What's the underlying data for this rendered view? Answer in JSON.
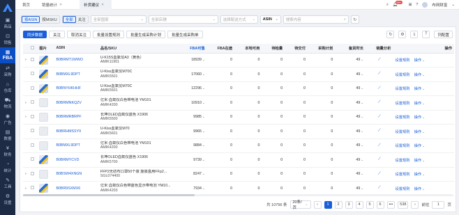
{
  "sidebar": {
    "items": [
      {
        "label": "商品",
        "icon": "box-icon"
      },
      {
        "label": "销售",
        "icon": "cart-icon"
      },
      {
        "label": "FBA",
        "icon": "fba-icon",
        "active": true
      },
      {
        "label": "采购",
        "icon": "purchase-icon"
      },
      {
        "label": "仓库",
        "icon": "warehouse-icon"
      },
      {
        "label": "物流",
        "icon": "truck-icon"
      },
      {
        "label": "广告",
        "icon": "ad-icon"
      },
      {
        "label": "数据",
        "icon": "chart-icon"
      },
      {
        "label": "财务",
        "icon": "finance-icon"
      },
      {
        "label": "统计",
        "icon": "stats-icon"
      },
      {
        "label": "工具",
        "icon": "tool-icon"
      },
      {
        "label": "设置",
        "icon": "settings-icon"
      }
    ]
  },
  "tabs": [
    {
      "label": "首页"
    },
    {
      "label": "销量统计"
    },
    {
      "label": "补货建议",
      "active": true
    }
  ],
  "topright": {
    "user": "布网财富",
    "badge": "99+"
  },
  "filters": {
    "seg1": [
      "按ASIN",
      "按MSKU"
    ],
    "seg2": [
      "全部",
      "关注"
    ],
    "country": "全部国家",
    "store": "全部店铺",
    "shipping": "选择配送方式",
    "search_field": "ASIN",
    "search_placeholder": "搜索内容"
  },
  "actions": [
    "同步数据",
    "关注",
    "取消关注",
    "批量设置规则",
    "批量生成采购计划",
    "批量生成采购单"
  ],
  "tools": {
    "column_config": "列配置"
  },
  "table": {
    "headers": [
      "图片",
      "ASIN",
      "品名/SKU",
      "FBA可售",
      "FBA在途",
      "本地可用",
      "待检量",
      "待交付",
      "采购计划",
      "备货时长",
      "销量分析",
      "操作"
    ],
    "rows": [
      {
        "asin": "B0BRMT1WWO",
        "name": "U-K15S血氧仪A3（黄色）",
        "sku": "AMIK11901",
        "fba": "18939",
        "inbound": "0",
        "local": "0",
        "inspect": "0",
        "deliver": "0",
        "plan": "0",
        "lead": "49",
        "expand": true,
        "pic": true
      },
      {
        "asin": "B0BMXL9DPT",
        "name": "U-Kiss血氧仪M70C",
        "sku": "AMIK5501",
        "fba": "17060",
        "inbound": "0",
        "local": "0",
        "inspect": "0",
        "deliver": "0",
        "plan": "0",
        "lead": "49",
        "expand": false,
        "pic": true
      },
      {
        "asin": "B0BNYHKHHF",
        "name": "U-Kiss血氧仪M70C",
        "sku": "AMIK5501",
        "fba": "12296",
        "inbound": "0",
        "local": "0",
        "inspect": "0",
        "deliver": "0",
        "plan": "0",
        "lead": "49",
        "expand": false,
        "pic": true
      },
      {
        "asin": "B0BRMNKQZV",
        "name": "亿米 血氧仪白色带电池 YM101",
        "sku": "AMIK4200",
        "fba": "10910",
        "inbound": "0",
        "local": "0",
        "inspect": "0",
        "deliver": "0",
        "plan": "0",
        "lead": "49",
        "expand": true,
        "pic": false
      },
      {
        "asin": "B0BRMRBRPF",
        "name": "长坤OLED血氧仪蓝色 X1906",
        "sku": "AMIK5500",
        "fba": "9985",
        "inbound": "0",
        "local": "0",
        "inspect": "0",
        "deliver": "0",
        "plan": "0",
        "lead": "49",
        "expand": true,
        "pic": false
      },
      {
        "asin": "B0BRHMSSY9",
        "name": "U-Kiss血氧仪M70",
        "sku": "AMIK5601",
        "fba": "9965",
        "inbound": "0",
        "local": "0",
        "inspect": "0",
        "deliver": "0",
        "plan": "0",
        "lead": "49",
        "expand": false,
        "pic": false
      },
      {
        "asin": "B0BMXL9DPT",
        "name": "亿米 血氧仪白色带电池 YM101",
        "sku": "AMIK4200",
        "fba": "9884",
        "inbound": "0",
        "local": "0",
        "inspect": "0",
        "deliver": "0",
        "plan": "0",
        "lead": "49",
        "expand": false,
        "pic": false
      },
      {
        "asin": "B0BRMYCVD",
        "name": "长坤OLED血氧仪蓝色 X1906",
        "sku": "AMIK5700",
        "fba": "9739",
        "inbound": "0",
        "local": "0",
        "inspect": "0",
        "deliver": "0",
        "plan": "0",
        "lead": "49",
        "expand": false,
        "pic": true
      },
      {
        "asin": "B0BSW4XNGN",
        "name": "FFP2无纺布口罩50个装 旋装盒用FFp2...",
        "sku": "SGL074400",
        "fba": "8247",
        "inbound": "0",
        "local": "0",
        "inspect": "0",
        "deliver": "0",
        "plan": "0",
        "lead": "49",
        "expand": true,
        "pic": false
      },
      {
        "asin": "B0BR9SXMX6",
        "name": "亿米 血氧仪白色带蓝色显示带电池 YM10...",
        "sku": "AMIK4203",
        "fba": "7934",
        "inbound": "0",
        "local": "0",
        "inspect": "0",
        "deliver": "0",
        "plan": "0",
        "lead": "49",
        "expand": true,
        "pic": true
      }
    ],
    "op_rule": "设置规则",
    "op_more": "操作"
  },
  "pager": {
    "total": "共 10756 条",
    "per_page": "20条/页",
    "pages": [
      "1",
      "2",
      "3",
      "4",
      "5",
      "6",
      "•••",
      "538"
    ],
    "current": "1",
    "goto": "前往",
    "goto_value": "1",
    "page_suffix": "页"
  }
}
